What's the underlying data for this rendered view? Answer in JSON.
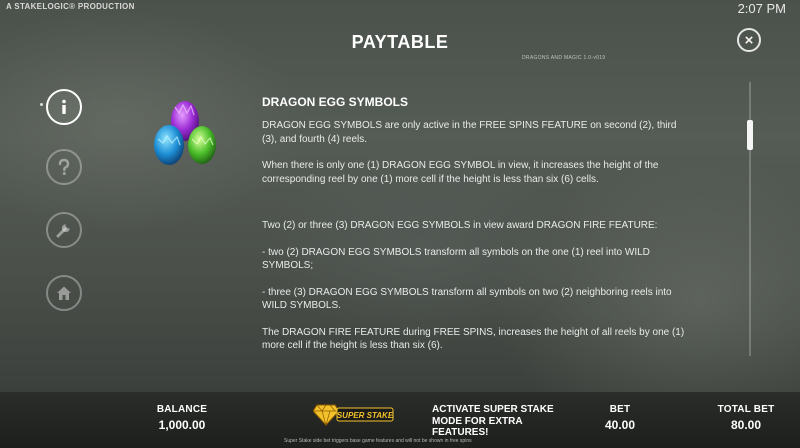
{
  "header": {
    "brand": "A STAKELOGIC® PRODUCTION",
    "clock": "2:07 PM",
    "title": "PAYTABLE",
    "version": "DRAGONS AND MAGIC 1.0-v019",
    "close_label": "×"
  },
  "sidebar": {
    "items": [
      {
        "icon": "info-icon",
        "active": true
      },
      {
        "icon": "question-icon",
        "active": false
      },
      {
        "icon": "wrench-icon",
        "active": false
      },
      {
        "icon": "home-icon",
        "active": false
      }
    ]
  },
  "section": {
    "heading": "DRAGON EGG SYMBOLS",
    "symbol_icon": "dragon-eggs-icon",
    "paragraphs": [
      "DRAGON EGG SYMBOLS are only active in the FREE SPINS FEATURE on second (2), third (3), and fourth (4) reels.",
      "When there is only one (1) DRAGON EGG SYMBOL in view, it increases the height of the corresponding reel by one (1) more cell if the height is less than six (6) cells.",
      "Two (2) or three (3) DRAGON EGG SYMBOLS in view award DRAGON FIRE FEATURE:",
      "- two (2) DRAGON EGG SYMBOLS transform all symbols on the one (1) reel into WILD SYMBOLS;",
      "- three (3) DRAGON EGG SYMBOLS transform all symbols on two (2) neighboring reels into WILD SYMBOLS.",
      "The DRAGON FIRE FEATURE during FREE SPINS, increases the height of all reels by one (1) more cell if the height is less than six (6)."
    ]
  },
  "scrollbar": {
    "position_fraction": 0.14
  },
  "bottom_bar": {
    "balance_label": "BALANCE",
    "balance_value": "1,000.00",
    "super_stake_logo": "SUPER STAKE",
    "super_stake_text": "ACTIVATE SUPER STAKE MODE FOR EXTRA FEATURES!",
    "super_stake_note": "Super Stake side bet triggers base game features and will not be shown in free spins",
    "bet_label": "BET",
    "bet_value": "40.00",
    "total_bet_label": "TOTAL BET",
    "total_bet_value": "80.00"
  },
  "colors": {
    "logo_gold": "#f3c22b",
    "bottom_bar": "#1d1f1d"
  }
}
